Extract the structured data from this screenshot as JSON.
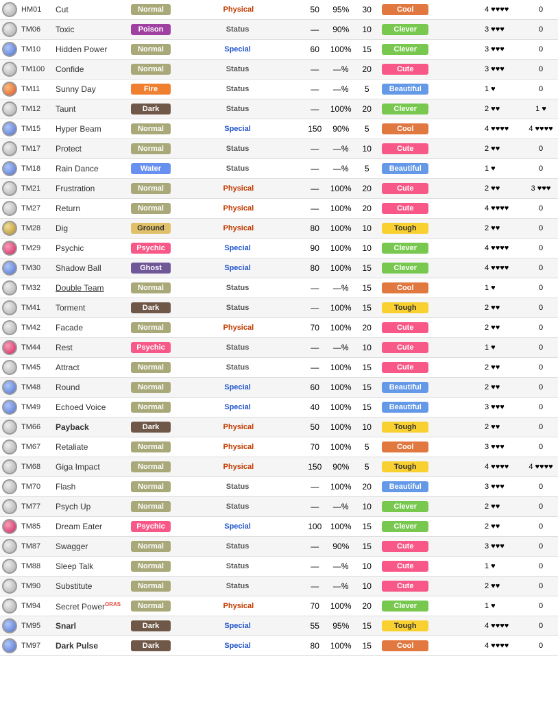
{
  "moves": [
    {
      "icon": "normal",
      "tm": "HM01",
      "name": "Cut",
      "name_style": "",
      "type": "Normal",
      "type_class": "type-normal",
      "category": "Physical",
      "cat_class": "cat-physical",
      "power": "50",
      "accuracy": "95%",
      "pp": "30",
      "contest": "Cool",
      "contest_class": "contest-cool",
      "appeal": "4 ♥♥♥♥",
      "jam": "0",
      "oras": false
    },
    {
      "icon": "poison",
      "tm": "TM06",
      "name": "Toxic",
      "name_style": "",
      "type": "Poison",
      "type_class": "type-poison",
      "category": "Status",
      "cat_class": "cat-status",
      "power": "—",
      "accuracy": "90%",
      "pp": "10",
      "contest": "Clever",
      "contest_class": "contest-clever",
      "appeal": "3 ♥♥♥",
      "jam": "0",
      "oras": false
    },
    {
      "icon": "special",
      "tm": "TM10",
      "name": "Hidden Power",
      "name_style": "",
      "type": "Normal",
      "type_class": "type-normal",
      "category": "Special",
      "cat_class": "cat-special",
      "power": "60",
      "accuracy": "100%",
      "pp": "15",
      "contest": "Clever",
      "contest_class": "contest-clever",
      "appeal": "3 ♥♥♥",
      "jam": "0",
      "oras": false
    },
    {
      "icon": "normal",
      "tm": "TM100",
      "name": "Confide",
      "name_style": "",
      "type": "Normal",
      "type_class": "type-normal",
      "category": "Status",
      "cat_class": "cat-status",
      "power": "—",
      "accuracy": "—%",
      "pp": "20",
      "contest": "Cute",
      "contest_class": "contest-cute",
      "appeal": "3 ♥♥♥",
      "jam": "0",
      "oras": false
    },
    {
      "icon": "fire",
      "tm": "TM11",
      "name": "Sunny Day",
      "name_style": "",
      "type": "Fire",
      "type_class": "type-fire",
      "category": "Status",
      "cat_class": "cat-status",
      "power": "—",
      "accuracy": "—%",
      "pp": "5",
      "contest": "Beautiful",
      "contest_class": "contest-beautiful",
      "appeal": "1 ♥",
      "jam": "0",
      "oras": false
    },
    {
      "icon": "normal",
      "tm": "TM12",
      "name": "Taunt",
      "name_style": "",
      "type": "Dark",
      "type_class": "type-dark",
      "category": "Status",
      "cat_class": "cat-status",
      "power": "—",
      "accuracy": "100%",
      "pp": "20",
      "contest": "Clever",
      "contest_class": "contest-clever",
      "appeal": "2 ♥♥",
      "jam": "1 ♥",
      "oras": false
    },
    {
      "icon": "special",
      "tm": "TM15",
      "name": "Hyper Beam",
      "name_style": "",
      "type": "Normal",
      "type_class": "type-normal",
      "category": "Special",
      "cat_class": "cat-special",
      "power": "150",
      "accuracy": "90%",
      "pp": "5",
      "contest": "Cool",
      "contest_class": "contest-cool",
      "appeal": "4 ♥♥♥♥",
      "jam": "4 ♥♥♥♥",
      "oras": false
    },
    {
      "icon": "normal",
      "tm": "TM17",
      "name": "Protect",
      "name_style": "",
      "type": "Normal",
      "type_class": "type-normal",
      "category": "Status",
      "cat_class": "cat-status",
      "power": "—",
      "accuracy": "—%",
      "pp": "10",
      "contest": "Cute",
      "contest_class": "contest-cute",
      "appeal": "2 ♥♥",
      "jam": "0",
      "oras": false
    },
    {
      "icon": "water",
      "tm": "TM18",
      "name": "Rain Dance",
      "name_style": "",
      "type": "Water",
      "type_class": "type-water",
      "category": "Status",
      "cat_class": "cat-status",
      "power": "—",
      "accuracy": "—%",
      "pp": "5",
      "contest": "Beautiful",
      "contest_class": "contest-beautiful",
      "appeal": "1 ♥",
      "jam": "0",
      "oras": false
    },
    {
      "icon": "normal",
      "tm": "TM21",
      "name": "Frustration",
      "name_style": "",
      "type": "Normal",
      "type_class": "type-normal",
      "category": "Physical",
      "cat_class": "cat-physical",
      "power": "—",
      "accuracy": "100%",
      "pp": "20",
      "contest": "Cute",
      "contest_class": "contest-cute",
      "appeal": "2 ♥♥",
      "jam": "3 ♥♥♥",
      "oras": false
    },
    {
      "icon": "normal",
      "tm": "TM27",
      "name": "Return",
      "name_style": "",
      "type": "Normal",
      "type_class": "type-normal",
      "category": "Physical",
      "cat_class": "cat-physical",
      "power": "—",
      "accuracy": "100%",
      "pp": "20",
      "contest": "Cute",
      "contest_class": "contest-cute",
      "appeal": "4 ♥♥♥♥",
      "jam": "0",
      "oras": false
    },
    {
      "icon": "ground",
      "tm": "TM28",
      "name": "Dig",
      "name_style": "",
      "type": "Ground",
      "type_class": "type-ground",
      "category": "Physical",
      "cat_class": "cat-physical",
      "power": "80",
      "accuracy": "100%",
      "pp": "10",
      "contest": "Tough",
      "contest_class": "contest-tough",
      "appeal": "2 ♥♥",
      "jam": "0",
      "oras": false
    },
    {
      "icon": "psychic",
      "tm": "TM29",
      "name": "Psychic",
      "name_style": "",
      "type": "Psychic",
      "type_class": "type-psychic",
      "category": "Special",
      "cat_class": "cat-special",
      "power": "90",
      "accuracy": "100%",
      "pp": "10",
      "contest": "Clever",
      "contest_class": "contest-clever",
      "appeal": "4 ♥♥♥♥",
      "jam": "0",
      "oras": false
    },
    {
      "icon": "special",
      "tm": "TM30",
      "name": "Shadow Ball",
      "name_style": "",
      "type": "Ghost",
      "type_class": "type-ghost",
      "category": "Special",
      "cat_class": "cat-special",
      "power": "80",
      "accuracy": "100%",
      "pp": "15",
      "contest": "Clever",
      "contest_class": "contest-clever",
      "appeal": "4 ♥♥♥♥",
      "jam": "0",
      "oras": false
    },
    {
      "icon": "normal",
      "tm": "TM32",
      "name": "Double Team",
      "name_style": "underline",
      "type": "Normal",
      "type_class": "type-normal",
      "category": "Status",
      "cat_class": "cat-status",
      "power": "—",
      "accuracy": "—%",
      "pp": "15",
      "contest": "Cool",
      "contest_class": "contest-cool",
      "appeal": "1 ♥",
      "jam": "0",
      "oras": false
    },
    {
      "icon": "normal",
      "tm": "TM41",
      "name": "Torment",
      "name_style": "",
      "type": "Dark",
      "type_class": "type-dark",
      "category": "Status",
      "cat_class": "cat-status",
      "power": "—",
      "accuracy": "100%",
      "pp": "15",
      "contest": "Tough",
      "contest_class": "contest-tough",
      "appeal": "2 ♥♥",
      "jam": "0",
      "oras": false
    },
    {
      "icon": "normal",
      "tm": "TM42",
      "name": "Facade",
      "name_style": "",
      "type": "Normal",
      "type_class": "type-normal",
      "category": "Physical",
      "cat_class": "cat-physical",
      "power": "70",
      "accuracy": "100%",
      "pp": "20",
      "contest": "Cute",
      "contest_class": "contest-cute",
      "appeal": "2 ♥♥",
      "jam": "0",
      "oras": false
    },
    {
      "icon": "psychic",
      "tm": "TM44",
      "name": "Rest",
      "name_style": "",
      "type": "Psychic",
      "type_class": "type-psychic",
      "category": "Status",
      "cat_class": "cat-status",
      "power": "—",
      "accuracy": "—%",
      "pp": "10",
      "contest": "Cute",
      "contest_class": "contest-cute",
      "appeal": "1 ♥",
      "jam": "0",
      "oras": false
    },
    {
      "icon": "normal",
      "tm": "TM45",
      "name": "Attract",
      "name_style": "",
      "type": "Normal",
      "type_class": "type-normal",
      "category": "Status",
      "cat_class": "cat-status",
      "power": "—",
      "accuracy": "100%",
      "pp": "15",
      "contest": "Cute",
      "contest_class": "contest-cute",
      "appeal": "2 ♥♥",
      "jam": "0",
      "oras": false
    },
    {
      "icon": "normal",
      "tm": "TM48",
      "name": "Round",
      "name_style": "",
      "type": "Normal",
      "type_class": "type-normal",
      "category": "Special",
      "cat_class": "cat-special",
      "power": "60",
      "accuracy": "100%",
      "pp": "15",
      "contest": "Beautiful",
      "contest_class": "contest-beautiful",
      "appeal": "2 ♥♥",
      "jam": "0",
      "oras": false
    },
    {
      "icon": "normal",
      "tm": "TM49",
      "name": "Echoed Voice",
      "name_style": "",
      "type": "Normal",
      "type_class": "type-normal",
      "category": "Special",
      "cat_class": "cat-special",
      "power": "40",
      "accuracy": "100%",
      "pp": "15",
      "contest": "Beautiful",
      "contest_class": "contest-beautiful",
      "appeal": "3 ♥♥♥",
      "jam": "0",
      "oras": false
    },
    {
      "icon": "normal",
      "tm": "TM66",
      "name": "Payback",
      "name_style": "bold",
      "type": "Dark",
      "type_class": "type-dark",
      "category": "Physical",
      "cat_class": "cat-physical",
      "power": "50",
      "accuracy": "100%",
      "pp": "10",
      "contest": "Tough",
      "contest_class": "contest-tough",
      "appeal": "2 ♥♥",
      "jam": "0",
      "oras": false
    },
    {
      "icon": "normal",
      "tm": "TM67",
      "name": "Retaliate",
      "name_style": "",
      "type": "Normal",
      "type_class": "type-normal",
      "category": "Physical",
      "cat_class": "cat-physical",
      "power": "70",
      "accuracy": "100%",
      "pp": "5",
      "contest": "Cool",
      "contest_class": "contest-cool",
      "appeal": "3 ♥♥♥",
      "jam": "0",
      "oras": false
    },
    {
      "icon": "normal",
      "tm": "TM68",
      "name": "Giga Impact",
      "name_style": "",
      "type": "Normal",
      "type_class": "type-normal",
      "category": "Physical",
      "cat_class": "cat-physical",
      "power": "150",
      "accuracy": "90%",
      "pp": "5",
      "contest": "Tough",
      "contest_class": "contest-tough",
      "appeal": "4 ♥♥♥♥",
      "jam": "4 ♥♥♥♥",
      "oras": false
    },
    {
      "icon": "normal",
      "tm": "TM70",
      "name": "Flash",
      "name_style": "",
      "type": "Normal",
      "type_class": "type-normal",
      "category": "Status",
      "cat_class": "cat-status",
      "power": "—",
      "accuracy": "100%",
      "pp": "20",
      "contest": "Beautiful",
      "contest_class": "contest-beautiful",
      "appeal": "3 ♥♥♥",
      "jam": "0",
      "oras": false
    },
    {
      "icon": "normal",
      "tm": "TM77",
      "name": "Psych Up",
      "name_style": "",
      "type": "Normal",
      "type_class": "type-normal",
      "category": "Status",
      "cat_class": "cat-status",
      "power": "—",
      "accuracy": "—%",
      "pp": "10",
      "contest": "Clever",
      "contest_class": "contest-clever",
      "appeal": "2 ♥♥",
      "jam": "0",
      "oras": false
    },
    {
      "icon": "psychic",
      "tm": "TM85",
      "name": "Dream Eater",
      "name_style": "",
      "type": "Psychic",
      "type_class": "type-psychic",
      "category": "Special",
      "cat_class": "cat-special",
      "power": "100",
      "accuracy": "100%",
      "pp": "15",
      "contest": "Clever",
      "contest_class": "contest-clever",
      "appeal": "2 ♥♥",
      "jam": "0",
      "oras": false
    },
    {
      "icon": "normal",
      "tm": "TM87",
      "name": "Swagger",
      "name_style": "",
      "type": "Normal",
      "type_class": "type-normal",
      "category": "Status",
      "cat_class": "cat-status",
      "power": "—",
      "accuracy": "90%",
      "pp": "15",
      "contest": "Cute",
      "contest_class": "contest-cute",
      "appeal": "3 ♥♥♥",
      "jam": "0",
      "oras": false
    },
    {
      "icon": "normal",
      "tm": "TM88",
      "name": "Sleep Talk",
      "name_style": "",
      "type": "Normal",
      "type_class": "type-normal",
      "category": "Status",
      "cat_class": "cat-status",
      "power": "—",
      "accuracy": "—%",
      "pp": "10",
      "contest": "Cute",
      "contest_class": "contest-cute",
      "appeal": "1 ♥",
      "jam": "0",
      "oras": false
    },
    {
      "icon": "normal",
      "tm": "TM90",
      "name": "Substitute",
      "name_style": "",
      "type": "Normal",
      "type_class": "type-normal",
      "category": "Status",
      "cat_class": "cat-status",
      "power": "—",
      "accuracy": "—%",
      "pp": "10",
      "contest": "Cute",
      "contest_class": "contest-cute",
      "appeal": "2 ♥♥",
      "jam": "0",
      "oras": false
    },
    {
      "icon": "normal",
      "tm": "TM94",
      "name": "Secret Power",
      "name_style": "",
      "type": "Normal",
      "type_class": "type-normal",
      "category": "Physical",
      "cat_class": "cat-physical",
      "power": "70",
      "accuracy": "100%",
      "pp": "20",
      "contest": "Clever",
      "contest_class": "contest-clever",
      "appeal": "1 ♥",
      "jam": "0",
      "oras": true
    },
    {
      "icon": "normal",
      "tm": "TM95",
      "name": "Snarl",
      "name_style": "bold",
      "type": "Dark",
      "type_class": "type-dark",
      "category": "Special",
      "cat_class": "cat-special",
      "power": "55",
      "accuracy": "95%",
      "pp": "15",
      "contest": "Tough",
      "contest_class": "contest-tough",
      "appeal": "4 ♥♥♥♥",
      "jam": "0",
      "oras": false
    },
    {
      "icon": "normal",
      "tm": "TM97",
      "name": "Dark Pulse",
      "name_style": "bold",
      "type": "Dark",
      "type_class": "type-dark",
      "category": "Special",
      "cat_class": "cat-special",
      "power": "80",
      "accuracy": "100%",
      "pp": "15",
      "contest": "Cool",
      "contest_class": "contest-cool",
      "appeal": "4 ♥♥♥♥",
      "jam": "0",
      "oras": false
    }
  ]
}
